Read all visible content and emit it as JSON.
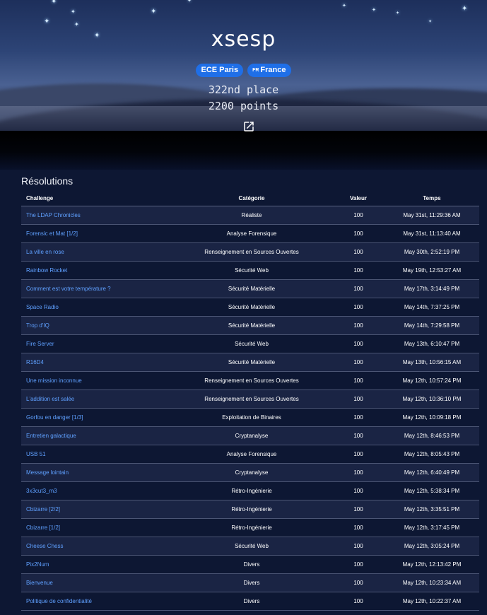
{
  "profile": {
    "username": "xsesp",
    "school_badge": "ECE Paris",
    "country_code": "FR",
    "country_badge": "France",
    "place": "322nd place",
    "points": "2200 points",
    "external_link_icon": "external-link-icon"
  },
  "colors": {
    "badge": "#1f6fe8",
    "link": "#5fa0ff",
    "background": "#0d1733"
  },
  "resolutions": {
    "title": "Résolutions",
    "headers": [
      "Challenge",
      "Catégorie",
      "Valeur",
      "Temps"
    ],
    "rows": [
      {
        "challenge": "The LDAP Chronicles",
        "category": "Réaliste",
        "value": "100",
        "time": "May 31st, 11:29:36 AM"
      },
      {
        "challenge": "Forensic et Mat [1/2]",
        "category": "Analyse Forensique",
        "value": "100",
        "time": "May 31st, 11:13:40 AM"
      },
      {
        "challenge": "La ville en rose",
        "category": "Renseignement en Sources Ouvertes",
        "value": "100",
        "time": "May 30th, 2:52:19 PM"
      },
      {
        "challenge": "Rainbow Rocket",
        "category": "Sécurité Web",
        "value": "100",
        "time": "May 19th, 12:53:27 AM"
      },
      {
        "challenge": "Comment est votre température ?",
        "category": "Sécurité Matérielle",
        "value": "100",
        "time": "May 17th, 3:14:49 PM"
      },
      {
        "challenge": "Space Radio",
        "category": "Sécurité Matérielle",
        "value": "100",
        "time": "May 14th, 7:37:25 PM"
      },
      {
        "challenge": "Trop d'IQ",
        "category": "Sécurité Matérielle",
        "value": "100",
        "time": "May 14th, 7:29:58 PM"
      },
      {
        "challenge": "Fire Server",
        "category": "Sécurité Web",
        "value": "100",
        "time": "May 13th, 6:10:47 PM"
      },
      {
        "challenge": "R16D4",
        "category": "Sécurité Matérielle",
        "value": "100",
        "time": "May 13th, 10:56:15 AM"
      },
      {
        "challenge": "Une mission inconnue",
        "category": "Renseignement en Sources Ouvertes",
        "value": "100",
        "time": "May 12th, 10:57:24 PM"
      },
      {
        "challenge": "L'addition est salée",
        "category": "Renseignement en Sources Ouvertes",
        "value": "100",
        "time": "May 12th, 10:36:10 PM"
      },
      {
        "challenge": "Gorfou en danger [1/3]",
        "category": "Exploitation de Binaires",
        "value": "100",
        "time": "May 12th, 10:09:18 PM"
      },
      {
        "challenge": "Entretien galactique",
        "category": "Cryptanalyse",
        "value": "100",
        "time": "May 12th, 8:46:53 PM"
      },
      {
        "challenge": "USB 51",
        "category": "Analyse Forensique",
        "value": "100",
        "time": "May 12th, 8:05:43 PM"
      },
      {
        "challenge": "Message lointain",
        "category": "Cryptanalyse",
        "value": "100",
        "time": "May 12th, 6:40:49 PM"
      },
      {
        "challenge": "3x3cut3_m3",
        "category": "Rétro-Ingénierie",
        "value": "100",
        "time": "May 12th, 5:38:34 PM"
      },
      {
        "challenge": "Cbizarre [2/2]",
        "category": "Rétro-Ingénierie",
        "value": "100",
        "time": "May 12th, 3:35:51 PM"
      },
      {
        "challenge": "Cbizarre [1/2]",
        "category": "Rétro-Ingénierie",
        "value": "100",
        "time": "May 12th, 3:17:45 PM"
      },
      {
        "challenge": "Cheese Chess",
        "category": "Sécurité Web",
        "value": "100",
        "time": "May 12th, 3:05:24 PM"
      },
      {
        "challenge": "Pix2Num",
        "category": "Divers",
        "value": "100",
        "time": "May 12th, 12:13:42 PM"
      },
      {
        "challenge": "Bienvenue",
        "category": "Divers",
        "value": "100",
        "time": "May 12th, 10:23:34 AM"
      },
      {
        "challenge": "Politique de confidentialité",
        "category": "Divers",
        "value": "100",
        "time": "May 12th, 10:22:37 AM"
      }
    ]
  }
}
